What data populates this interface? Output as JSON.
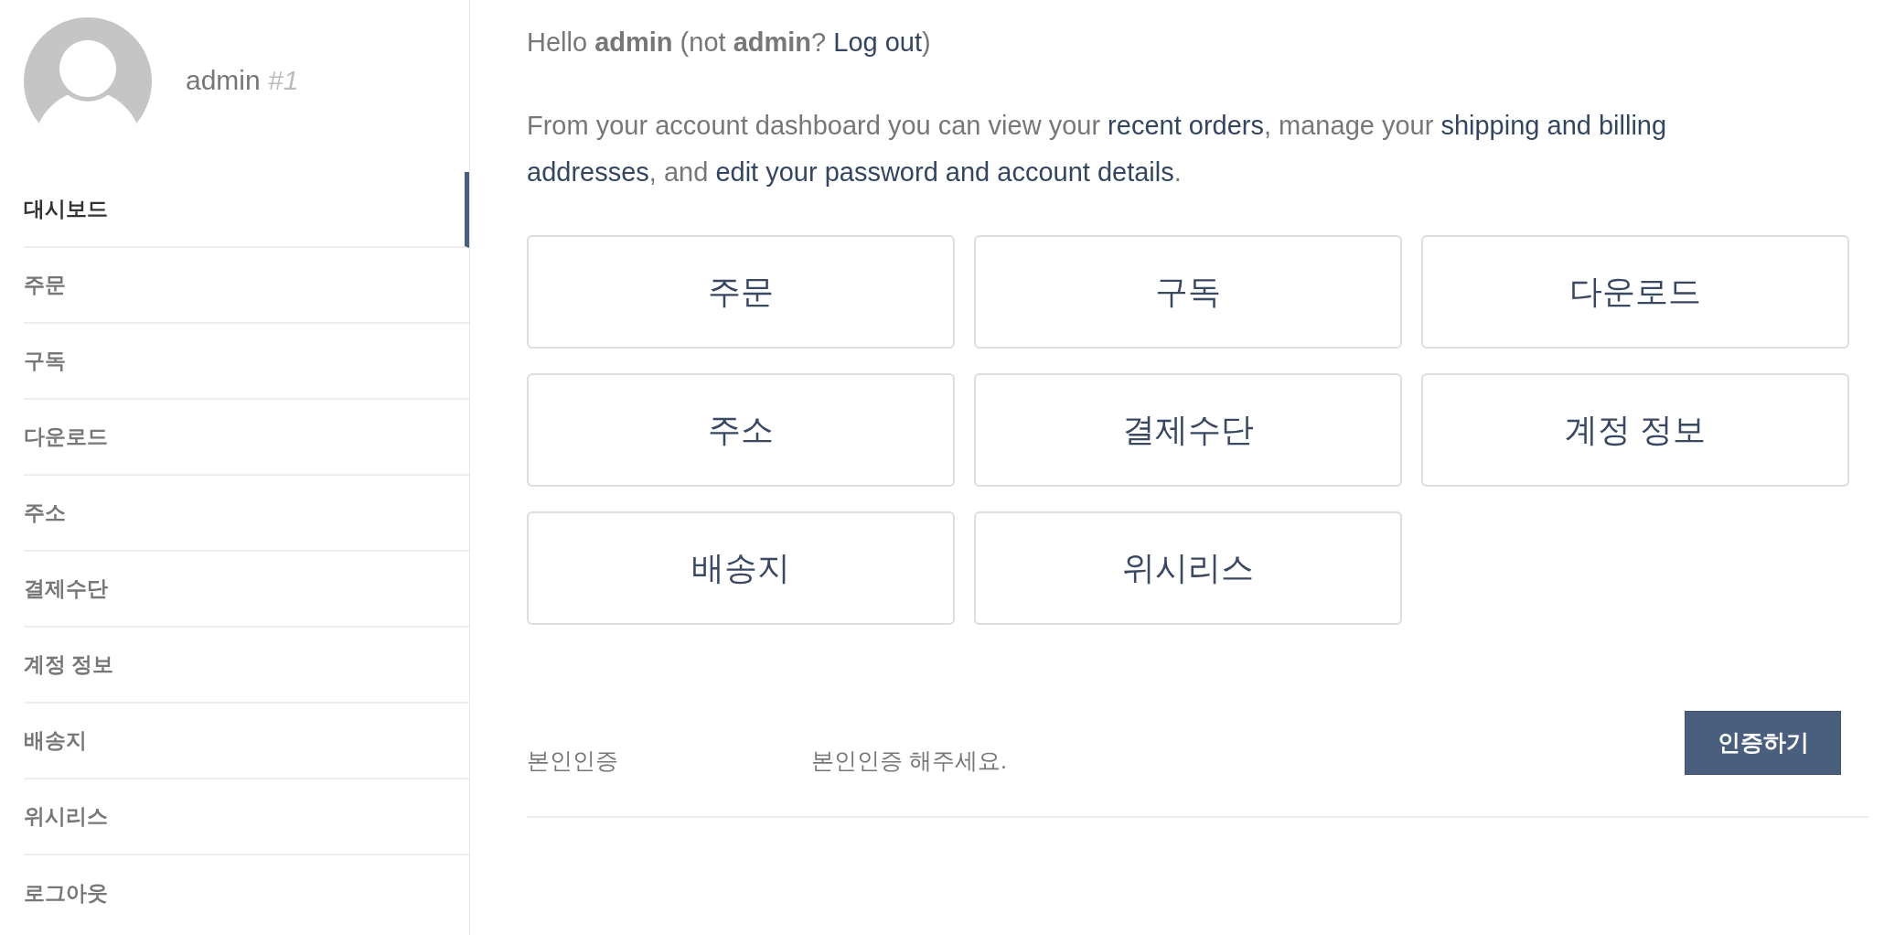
{
  "user": {
    "name": "admin",
    "number": "#1"
  },
  "sidebar": {
    "items": [
      {
        "label": "대시보드",
        "selected": true
      },
      {
        "label": "주문",
        "selected": false
      },
      {
        "label": "구독",
        "selected": false
      },
      {
        "label": "다운로드",
        "selected": false
      },
      {
        "label": "주소",
        "selected": false
      },
      {
        "label": "결제수단",
        "selected": false
      },
      {
        "label": "계정 정보",
        "selected": false
      },
      {
        "label": "배송지",
        "selected": false
      },
      {
        "label": "위시리스",
        "selected": false
      },
      {
        "label": "로그아웃",
        "selected": false
      }
    ]
  },
  "greeting": {
    "parts": [
      {
        "kind": "plain",
        "text": "Hello "
      },
      {
        "kind": "bold",
        "text": "admin"
      },
      {
        "kind": "plain",
        "text": " (not "
      },
      {
        "kind": "bold",
        "text": "admin"
      },
      {
        "kind": "plain",
        "text": "? "
      },
      {
        "kind": "link",
        "text": "Log out"
      },
      {
        "kind": "plain",
        "text": ")"
      }
    ]
  },
  "intro": {
    "lines": [
      [
        {
          "kind": "plain",
          "text": "From your account dashboard you can view your "
        },
        {
          "kind": "link",
          "text": "recent orders"
        },
        {
          "kind": "plain",
          "text": ", manage your "
        },
        {
          "kind": "link",
          "text": "shipping and billing"
        }
      ],
      [
        {
          "kind": "link",
          "text": "addresses"
        },
        {
          "kind": "plain",
          "text": ", and "
        },
        {
          "kind": "link",
          "text": "edit your password and account details"
        },
        {
          "kind": "plain",
          "text": "."
        }
      ]
    ]
  },
  "tiles": [
    {
      "label": "주문"
    },
    {
      "label": "구독"
    },
    {
      "label": "다운로드"
    },
    {
      "label": "주소"
    },
    {
      "label": "결제수단"
    },
    {
      "label": "계정 정보"
    },
    {
      "label": "배송지"
    },
    {
      "label": "위시리스"
    }
  ],
  "verification": {
    "label": "본인인증",
    "message": "본인인증 해주세요.",
    "button": "인증하기"
  }
}
